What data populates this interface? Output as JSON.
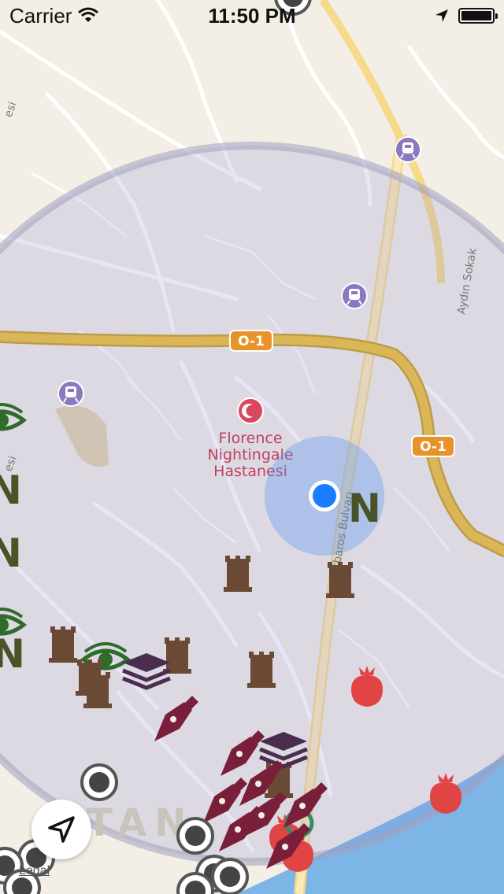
{
  "status_bar": {
    "carrier": "Carrier",
    "time": "11:50 PM",
    "icons": [
      "wifi-icon",
      "location-arrow-icon",
      "battery-icon"
    ]
  },
  "map": {
    "poi_hospital": {
      "line1": "Florence",
      "line2": "Nightingale",
      "line3": "Hastanesi",
      "icon": "hospital-crescent-icon"
    },
    "road_shields": [
      "O-1",
      "O-1"
    ],
    "street_labels": [
      "Aydın Sokak",
      "Barbaros Bulvarı"
    ],
    "edge_label_fragments": [
      "esi",
      "esi"
    ],
    "watermark": "TAN",
    "colors": {
      "highway": "#f1c232",
      "shield": "#e8922a",
      "transit": "#8a78c0",
      "hospital": "#d9475f",
      "water": "#7cb5e6",
      "region": "rgba(140,140,220,0.22)",
      "user_dot": "#1a7cff"
    },
    "markers": [
      {
        "type": "eye-icon"
      },
      {
        "type": "letter-n-icon"
      },
      {
        "type": "tower-icon"
      },
      {
        "type": "layers-icon"
      },
      {
        "type": "pen-nib-icon"
      },
      {
        "type": "pomegranate-icon"
      },
      {
        "type": "circle-marker-icon"
      },
      {
        "type": "train-icon"
      }
    ]
  },
  "marker_letter": "N",
  "controls": {
    "locate_button_icon": "navigation-arrow-icon",
    "legal_label": "Legal"
  }
}
